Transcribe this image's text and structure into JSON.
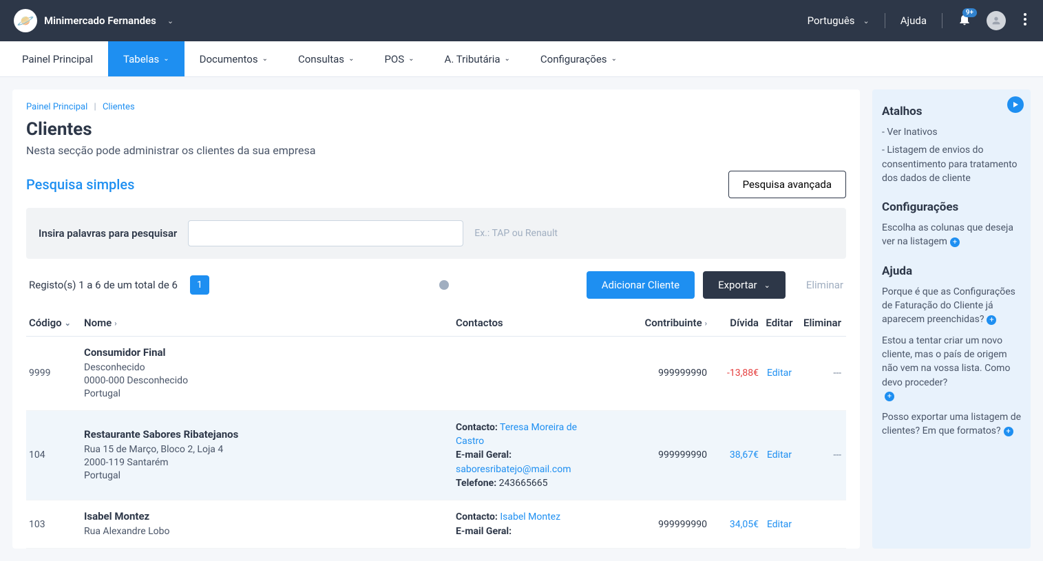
{
  "topbar": {
    "company": "Minimercado Fernandes",
    "language": "Português",
    "help": "Ajuda",
    "badge": "9+"
  },
  "nav": {
    "painel": "Painel Principal",
    "tabelas": "Tabelas",
    "documentos": "Documentos",
    "consultas": "Consultas",
    "pos": "POS",
    "at": "A. Tributária",
    "config": "Configurações"
  },
  "breadcrumb": {
    "home": "Painel Principal",
    "current": "Clientes"
  },
  "page": {
    "title": "Clientes",
    "subtitle": "Nesta secção pode administrar os clientes da sua empresa",
    "simple_search": "Pesquisa simples",
    "advanced_search": "Pesquisa avançada",
    "search_label": "Insira palavras para pesquisar",
    "search_hint": "Ex.: TAP ou Renault",
    "records": "Registo(s) 1 a 6 de um total de 6",
    "page_num": "1",
    "add_btn": "Adicionar Cliente",
    "export_btn": "Exportar",
    "elim_btn": "Eliminar"
  },
  "cols": {
    "codigo": "Código",
    "nome": "Nome",
    "contactos": "Contactos",
    "contribuinte": "Contribuinte",
    "divida": "Dívida",
    "editar": "Editar",
    "eliminar": "Eliminar"
  },
  "rows": {
    "r0": {
      "codigo": "9999",
      "nome": "Consumidor Final",
      "addr1": "Desconhecido",
      "addr2": "0000-000 Desconhecido",
      "addr3": "Portugal",
      "contrib": "999999990",
      "divida": "-13,88€",
      "edit": "Editar",
      "elim": "---"
    },
    "r1": {
      "codigo": "104",
      "nome": "Restaurante Sabores Ribatejanos",
      "addr1": "Rua 15 de Março, Bloco 2, Loja 4",
      "addr2": "2000-119 Santarém",
      "addr3": "Portugal",
      "c_label": "Contacto:",
      "c_name": "Teresa Moreira de Castro",
      "e_label": "E-mail Geral:",
      "e_val": "saboresribatejo@mail.com",
      "t_label": "Telefone:",
      "t_val": "243665665",
      "contrib": "999999990",
      "divida": "38,67€",
      "edit": "Editar",
      "elim": "---"
    },
    "r2": {
      "codigo": "103",
      "nome": "Isabel Montez",
      "addr1": "Rua Alexandre Lobo",
      "c_label": "Contacto:",
      "c_name": "Isabel Montez",
      "e_label": "E-mail Geral:",
      "contrib": "999999990",
      "divida": "34,05€",
      "edit": "Editar"
    }
  },
  "side": {
    "atalhos": "Atalhos",
    "a1": "- Ver Inativos",
    "a2": "- Listagem de envios do consentimento para tratamento dos dados de cliente",
    "config": "Configurações",
    "config_text": "Escolha as colunas que deseja ver na listagem",
    "ajuda": "Ajuda",
    "h1": "Porque é que as Configurações de Faturação do Cliente já aparecem preenchidas?",
    "h2": "Estou a tentar criar um novo cliente, mas o país de origem não vem na vossa lista. Como devo proceder?",
    "h3": "Posso exportar uma listagem de clientes? Em que formatos?"
  }
}
